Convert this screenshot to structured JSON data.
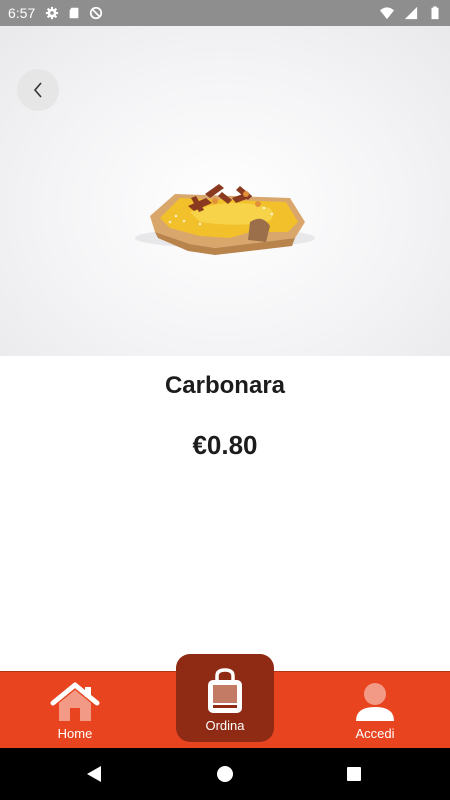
{
  "status_bar": {
    "time": "6:57",
    "left_icons": [
      "gear-icon",
      "sd-card-icon",
      "no-sync-icon"
    ],
    "right_icons": [
      "wifi-icon",
      "signal-icon",
      "battery-icon"
    ]
  },
  "product": {
    "name": "Carbonara",
    "price": "€0.80",
    "image": "pizza-slice-carbonara"
  },
  "bottom_nav": {
    "items": [
      {
        "label": "Home",
        "icon": "home-icon"
      },
      {
        "label": "Ordina",
        "icon": "shopping-bag-icon",
        "active": true
      },
      {
        "label": "Accedi",
        "icon": "user-icon"
      }
    ]
  },
  "colors": {
    "accent": "#e94420",
    "active_tab": "#8f2b14",
    "status_bar": "#8e8e8e"
  }
}
